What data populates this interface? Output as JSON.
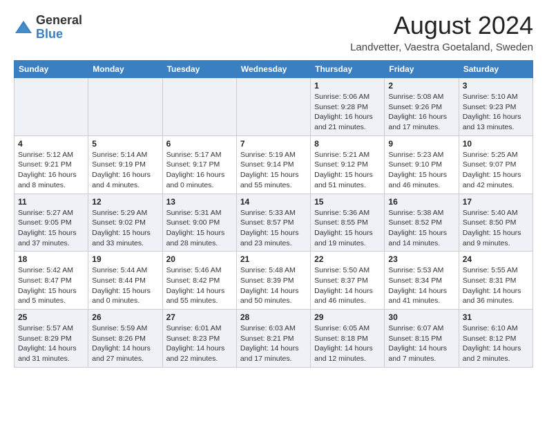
{
  "header": {
    "logo_general": "General",
    "logo_blue": "Blue",
    "month_year": "August 2024",
    "location": "Landvetter, Vaestra Goetaland, Sweden"
  },
  "days_of_week": [
    "Sunday",
    "Monday",
    "Tuesday",
    "Wednesday",
    "Thursday",
    "Friday",
    "Saturday"
  ],
  "weeks": [
    [
      {
        "day": "",
        "info": ""
      },
      {
        "day": "",
        "info": ""
      },
      {
        "day": "",
        "info": ""
      },
      {
        "day": "",
        "info": ""
      },
      {
        "day": "1",
        "info": "Sunrise: 5:06 AM\nSunset: 9:28 PM\nDaylight: 16 hours\nand 21 minutes."
      },
      {
        "day": "2",
        "info": "Sunrise: 5:08 AM\nSunset: 9:26 PM\nDaylight: 16 hours\nand 17 minutes."
      },
      {
        "day": "3",
        "info": "Sunrise: 5:10 AM\nSunset: 9:23 PM\nDaylight: 16 hours\nand 13 minutes."
      }
    ],
    [
      {
        "day": "4",
        "info": "Sunrise: 5:12 AM\nSunset: 9:21 PM\nDaylight: 16 hours\nand 8 minutes."
      },
      {
        "day": "5",
        "info": "Sunrise: 5:14 AM\nSunset: 9:19 PM\nDaylight: 16 hours\nand 4 minutes."
      },
      {
        "day": "6",
        "info": "Sunrise: 5:17 AM\nSunset: 9:17 PM\nDaylight: 16 hours\nand 0 minutes."
      },
      {
        "day": "7",
        "info": "Sunrise: 5:19 AM\nSunset: 9:14 PM\nDaylight: 15 hours\nand 55 minutes."
      },
      {
        "day": "8",
        "info": "Sunrise: 5:21 AM\nSunset: 9:12 PM\nDaylight: 15 hours\nand 51 minutes."
      },
      {
        "day": "9",
        "info": "Sunrise: 5:23 AM\nSunset: 9:10 PM\nDaylight: 15 hours\nand 46 minutes."
      },
      {
        "day": "10",
        "info": "Sunrise: 5:25 AM\nSunset: 9:07 PM\nDaylight: 15 hours\nand 42 minutes."
      }
    ],
    [
      {
        "day": "11",
        "info": "Sunrise: 5:27 AM\nSunset: 9:05 PM\nDaylight: 15 hours\nand 37 minutes."
      },
      {
        "day": "12",
        "info": "Sunrise: 5:29 AM\nSunset: 9:02 PM\nDaylight: 15 hours\nand 33 minutes."
      },
      {
        "day": "13",
        "info": "Sunrise: 5:31 AM\nSunset: 9:00 PM\nDaylight: 15 hours\nand 28 minutes."
      },
      {
        "day": "14",
        "info": "Sunrise: 5:33 AM\nSunset: 8:57 PM\nDaylight: 15 hours\nand 23 minutes."
      },
      {
        "day": "15",
        "info": "Sunrise: 5:36 AM\nSunset: 8:55 PM\nDaylight: 15 hours\nand 19 minutes."
      },
      {
        "day": "16",
        "info": "Sunrise: 5:38 AM\nSunset: 8:52 PM\nDaylight: 15 hours\nand 14 minutes."
      },
      {
        "day": "17",
        "info": "Sunrise: 5:40 AM\nSunset: 8:50 PM\nDaylight: 15 hours\nand 9 minutes."
      }
    ],
    [
      {
        "day": "18",
        "info": "Sunrise: 5:42 AM\nSunset: 8:47 PM\nDaylight: 15 hours\nand 5 minutes."
      },
      {
        "day": "19",
        "info": "Sunrise: 5:44 AM\nSunset: 8:44 PM\nDaylight: 15 hours\nand 0 minutes."
      },
      {
        "day": "20",
        "info": "Sunrise: 5:46 AM\nSunset: 8:42 PM\nDaylight: 14 hours\nand 55 minutes."
      },
      {
        "day": "21",
        "info": "Sunrise: 5:48 AM\nSunset: 8:39 PM\nDaylight: 14 hours\nand 50 minutes."
      },
      {
        "day": "22",
        "info": "Sunrise: 5:50 AM\nSunset: 8:37 PM\nDaylight: 14 hours\nand 46 minutes."
      },
      {
        "day": "23",
        "info": "Sunrise: 5:53 AM\nSunset: 8:34 PM\nDaylight: 14 hours\nand 41 minutes."
      },
      {
        "day": "24",
        "info": "Sunrise: 5:55 AM\nSunset: 8:31 PM\nDaylight: 14 hours\nand 36 minutes."
      }
    ],
    [
      {
        "day": "25",
        "info": "Sunrise: 5:57 AM\nSunset: 8:29 PM\nDaylight: 14 hours\nand 31 minutes."
      },
      {
        "day": "26",
        "info": "Sunrise: 5:59 AM\nSunset: 8:26 PM\nDaylight: 14 hours\nand 27 minutes."
      },
      {
        "day": "27",
        "info": "Sunrise: 6:01 AM\nSunset: 8:23 PM\nDaylight: 14 hours\nand 22 minutes."
      },
      {
        "day": "28",
        "info": "Sunrise: 6:03 AM\nSunset: 8:21 PM\nDaylight: 14 hours\nand 17 minutes."
      },
      {
        "day": "29",
        "info": "Sunrise: 6:05 AM\nSunset: 8:18 PM\nDaylight: 14 hours\nand 12 minutes."
      },
      {
        "day": "30",
        "info": "Sunrise: 6:07 AM\nSunset: 8:15 PM\nDaylight: 14 hours\nand 7 minutes."
      },
      {
        "day": "31",
        "info": "Sunrise: 6:10 AM\nSunset: 8:12 PM\nDaylight: 14 hours\nand 2 minutes."
      }
    ]
  ]
}
